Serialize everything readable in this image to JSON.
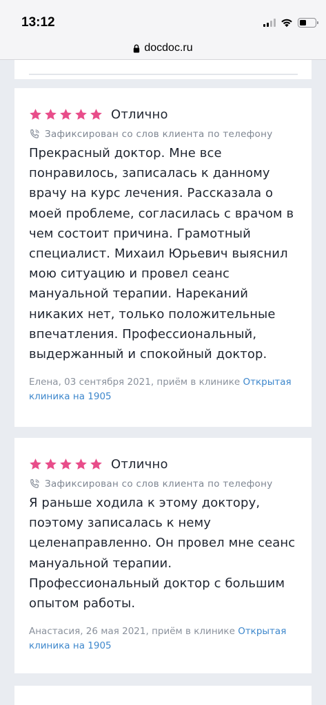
{
  "status_bar": {
    "time": "13:12"
  },
  "browser": {
    "url": "docdoc.ru"
  },
  "reviews": [
    {
      "rating_label": "Отлично",
      "stars": 5,
      "source": "Зафиксирован со слов клиента по телефону",
      "text": "Прекрасный доктор. Мне все понравилось, записалась к данному врачу на курс лечения. Рассказала о моей проблеме, согласилась с врачом в чем состоит причина. Грамотный специалист. Михаил Юрьевич выяснил мою ситуацию и провел сеанс мануальной терапии. Нареканий никаких нет, только положительные впечатления. Профессиональный, выдержанный и спокойный доктор.",
      "meta": "Елена, 03 сентября 2021, приём в клинике ",
      "clinic": "Открытая клиника на 1905"
    },
    {
      "rating_label": "Отлично",
      "stars": 5,
      "source": "Зафиксирован со слов клиента по телефону",
      "text": "Я раньше ходила к этому доктору, поэтому записалась к нему целенаправленно. Он провел мне сеанс мануальной терапии. Профессиональный доктор с большим опытом работы.",
      "meta": "Анастасия, 26 мая 2021, приём в клинике ",
      "clinic": "Открытая клиника на 1905"
    }
  ],
  "colors": {
    "star": "#e84d8a",
    "link": "#3d87cc",
    "page_background": "#e9ecf1"
  },
  "icons": [
    "lock-icon",
    "signal-icon",
    "wifi-icon",
    "battery-icon",
    "phone-icon",
    "star-icon"
  ]
}
